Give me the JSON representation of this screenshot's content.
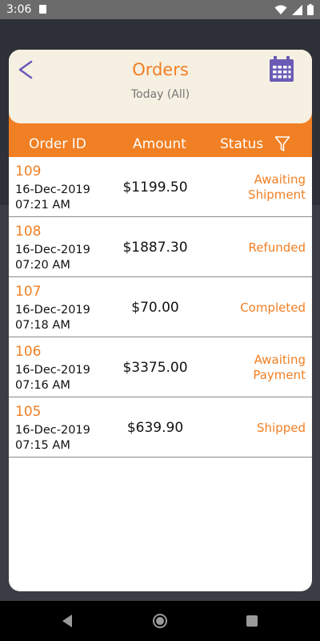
{
  "status_bar": {
    "time": "3:06"
  },
  "header": {
    "title": "Orders",
    "subtitle": "Today (All)"
  },
  "columns": {
    "order_id": "Order ID",
    "amount": "Amount",
    "status": "Status"
  },
  "orders": [
    {
      "id": "109",
      "date": "16-Dec-2019",
      "time": "07:21 AM",
      "amount": "$1199.50",
      "status_line1": "Awaiting",
      "status_line2": "Shipment"
    },
    {
      "id": "108",
      "date": "16-Dec-2019",
      "time": "07:20 AM",
      "amount": "$1887.30",
      "status_line1": "Refunded",
      "status_line2": ""
    },
    {
      "id": "107",
      "date": "16-Dec-2019",
      "time": "07:18 AM",
      "amount": "$70.00",
      "status_line1": "Completed",
      "status_line2": ""
    },
    {
      "id": "106",
      "date": "16-Dec-2019",
      "time": "07:16 AM",
      "amount": "$3375.00",
      "status_line1": "Awaiting",
      "status_line2": "Payment"
    },
    {
      "id": "105",
      "date": "16-Dec-2019",
      "time": "07:15 AM",
      "amount": "$639.90",
      "status_line1": "Shipped",
      "status_line2": ""
    }
  ],
  "colors": {
    "accent": "#f17f23",
    "header_bg": "#f6f0e2",
    "icon_purple": "#6b5bb5"
  },
  "icons": {
    "back": "back-arrow-icon",
    "calendar": "calendar-icon",
    "filter": "filter-icon"
  }
}
